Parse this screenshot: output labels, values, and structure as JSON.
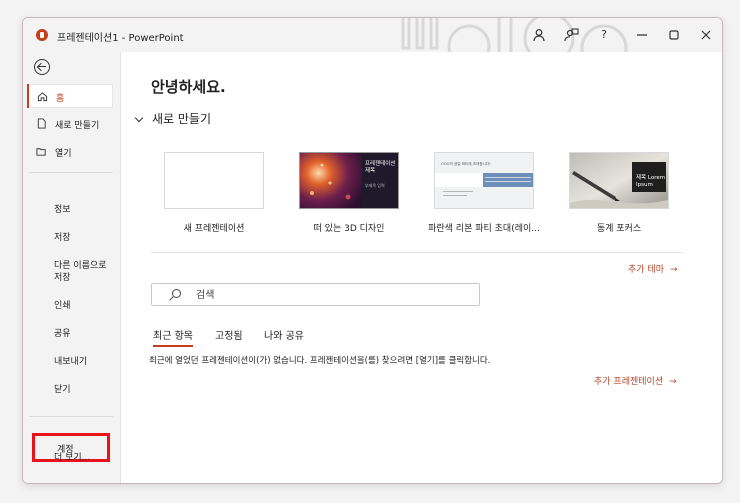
{
  "window": {
    "title": "프레젠테이션1 - PowerPoint",
    "accent": "#c43e1c"
  },
  "titlebar": {
    "icons": [
      "user-icon",
      "feedback-icon",
      "help-icon",
      "minimize-icon",
      "maximize-icon",
      "close-icon"
    ]
  },
  "sidebar": {
    "items": [
      {
        "label": "홈",
        "icon": "home-icon",
        "active": true
      },
      {
        "label": "새로 만들기",
        "icon": "new-file-icon"
      },
      {
        "label": "열기",
        "icon": "folder-open-icon"
      }
    ],
    "secondary": [
      "정보",
      "저장",
      "다른 이름으로 저장",
      "인쇄",
      "공유",
      "내보내기",
      "닫기"
    ],
    "account": "계정",
    "more": "더 보기..."
  },
  "main": {
    "greeting": "안녕하세요.",
    "new_section": "새로 만들기",
    "templates": [
      {
        "label": "새 프레젠테이션"
      },
      {
        "label": "떠 있는 3D 디자인",
        "thumb_title": "프레젠테이션 제목",
        "thumb_sub": "부제목 입력"
      },
      {
        "label": "파란색 리본 파티 초대(레이...",
        "thumb_title": "OOO의 생일 파티에 초대합니다!"
      },
      {
        "label": "동계 포커스",
        "thumb_title": "제목 Lorem Ipsum"
      }
    ],
    "more_themes": "추가 테마",
    "search_placeholder": "검색",
    "tabs": [
      {
        "label": "최근 항목",
        "active": true
      },
      {
        "label": "고정됨"
      },
      {
        "label": "나와 공유"
      }
    ],
    "empty_message": "최근에 열었던 프레젠테이션이(가) 없습니다. 프레젠테이션을(를) 찾으려면 [열기]를 클릭합니다.",
    "more_presentations": "추가 프레젠테이션"
  }
}
